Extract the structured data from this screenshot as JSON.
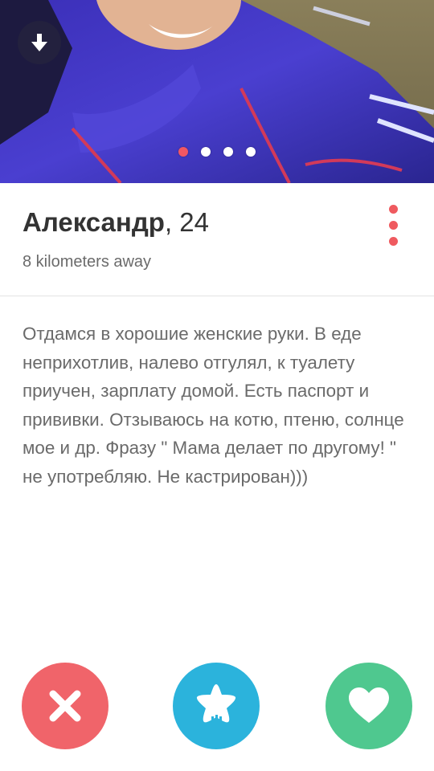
{
  "photo": {
    "icon": "arrow-down-icon",
    "pages": 4,
    "active_page": 1
  },
  "profile": {
    "name": "Александр",
    "age_text": ", 24",
    "distance": "8 kilometers away",
    "menu_icon": "more-vertical-icon"
  },
  "bio": {
    "text": "Отдамся в хорошие женские руки. В еде неприхотлив, налево отгулял, к туалету приучен, зарплату домой. Есть паспорт и прививки. Отзываюсь на котю, птеню, солнце мое и др. Фразу \" Мама делает по другому! \" не употребляю. Не кастрирован)))"
  },
  "actions": [
    {
      "icon": "close-icon",
      "color": "#f0646a"
    },
    {
      "icon": "super-like-star-icon",
      "color": "#2bb3dc"
    },
    {
      "icon": "heart-icon",
      "color": "#4fc88f"
    }
  ],
  "colors": {
    "accent": "#f25763",
    "text_primary": "#333333",
    "text_secondary": "#6b6b6b"
  }
}
